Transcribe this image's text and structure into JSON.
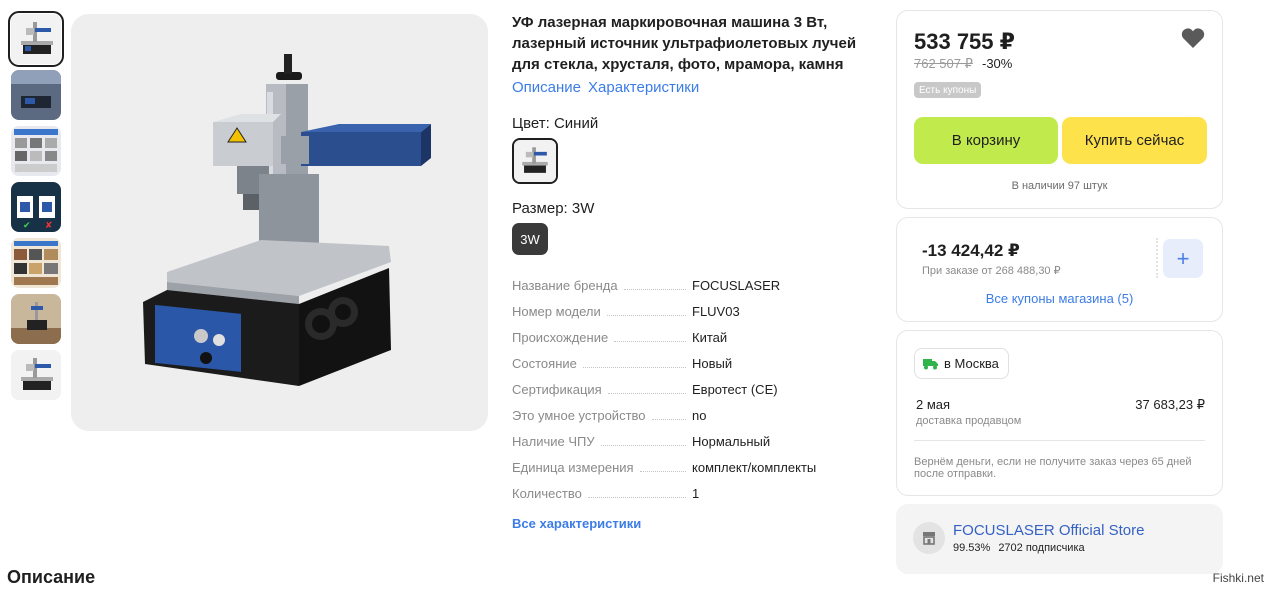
{
  "product": {
    "title": "УФ лазерная маркировочная машина 3 Вт, лазерный источник ультрафиолетовых лучей для стекла, хрусталя, фото, мрамора, камня",
    "links": [
      "Описание",
      "Характеристики"
    ],
    "color_label": "Цвет: Синий",
    "size_label": "Размер: 3W",
    "size_value": "3W",
    "specs": [
      {
        "key": "Название бренда",
        "value": "FOCUSLASER"
      },
      {
        "key": "Номер модели",
        "value": "FLUV03"
      },
      {
        "key": "Происхождение",
        "value": "Китай"
      },
      {
        "key": "Состояние",
        "value": "Новый"
      },
      {
        "key": "Сертификация",
        "value": "Евротест (CE)"
      },
      {
        "key": "Это умное устройство",
        "value": "no"
      },
      {
        "key": "Наличие ЧПУ",
        "value": "Нормальный"
      },
      {
        "key": "Единица измерения",
        "value": "комплект/комплекты"
      },
      {
        "key": "Количество",
        "value": "1"
      }
    ],
    "all_specs_link": "Все характеристики"
  },
  "price_card": {
    "price": "533 755 ₽",
    "old_price": "762 507 ₽",
    "discount": "-30%",
    "coupon_badge": "Есть купоны",
    "cart_button": "В корзину",
    "buy_button": "Купить сейчас",
    "stock": "В наличии 97 штук",
    "icon": "heart-icon"
  },
  "coupon_card": {
    "amount": "-13 424,42 ₽",
    "condition": "При заказе от 268 488,30 ₽",
    "plus": "+",
    "all_coupons": "Все купоны магазина (5)"
  },
  "delivery_card": {
    "city": "в Москва",
    "date": "2 мая",
    "subtitle": "доставка продавцом",
    "price": "37 683,23 ₽",
    "refund_note": "Вернём деньги, если не получите заказ через 65 дней после отправки.",
    "accent": "#2fb34a"
  },
  "store": {
    "name": "FOCUSLASER Official Store",
    "rating": "99.53%",
    "subscribers": "2702 подписчика"
  },
  "description_heading": "Описание",
  "watermark": "Fishki.net",
  "thumbnail_count": 7
}
